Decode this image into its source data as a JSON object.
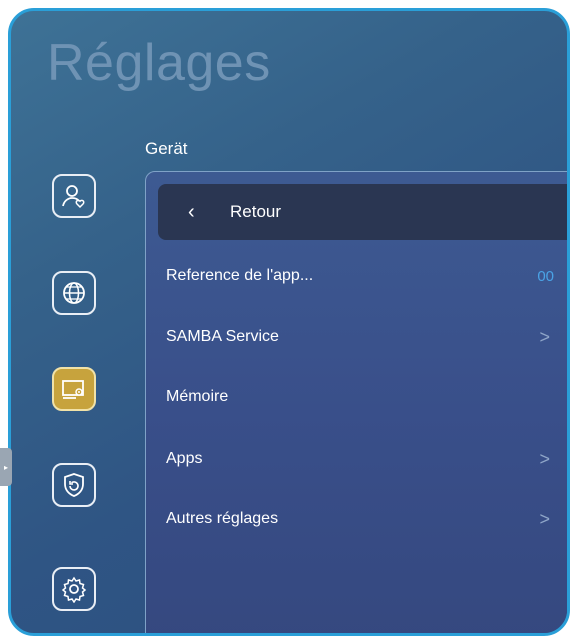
{
  "title": "Réglages",
  "section_title": "Gerät",
  "sidebar": {
    "icons": [
      {
        "name": "user-heart-icon",
        "active": false
      },
      {
        "name": "globe-icon",
        "active": false
      },
      {
        "name": "device-settings-icon",
        "active": true
      },
      {
        "name": "shield-icon",
        "active": false
      },
      {
        "name": "gear-icon",
        "active": false
      }
    ]
  },
  "panel": {
    "back_label": "Retour",
    "items": [
      {
        "label": "Reference de l'app...",
        "value": "00",
        "chevron": ""
      },
      {
        "label": "SAMBA Service",
        "value": "",
        "chevron": ">"
      },
      {
        "label": "Mémoire",
        "value": "",
        "chevron": ""
      },
      {
        "label": "Apps",
        "value": "",
        "chevron": ">"
      },
      {
        "label": "Autres réglages",
        "value": "",
        "chevron": ">"
      }
    ]
  },
  "colors": {
    "accent_border": "#2a9fd8",
    "active_icon": "#c7a33d",
    "value_text": "#4aa3e6"
  }
}
